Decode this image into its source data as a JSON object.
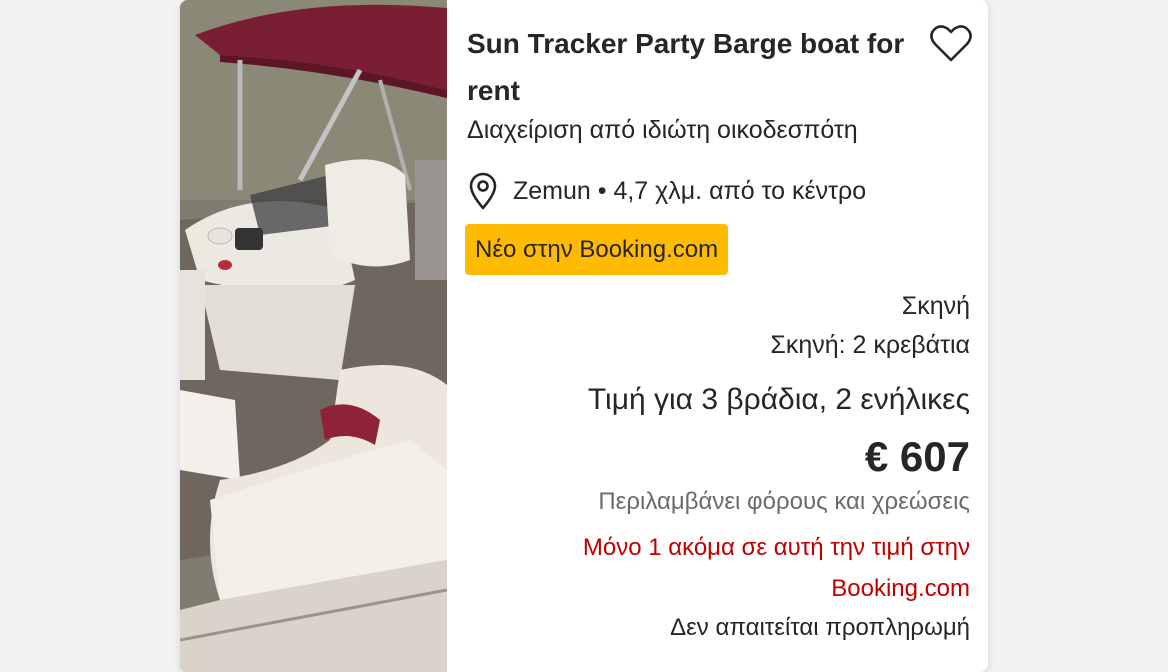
{
  "listing": {
    "title": "Sun Tracker Party Barge boat for rent",
    "subtitle": "Διαχείριση από ιδιώτη οικοδεσπότη",
    "location": "Zemun • 4,7 χλμ. από το κέντρο",
    "badge": "Νέο στην Booking.com",
    "room_type": "Σκηνή",
    "beds": "Σκηνή: 2 κρεβάτια",
    "price_for": "Τιμή για 3 βράδια, 2 ενήλικες",
    "price": "€ 607",
    "taxes": "Περιλαμβάνει φόρους και χρεώσεις",
    "scarcity": "Μόνο 1 ακόμα σε αυτή την τιμή στην Booking.com",
    "prepayment": "Δεν απαιτείται προπληρωμή"
  },
  "icons": {
    "favorite": "heart-icon",
    "location": "map-pin-icon"
  },
  "colors": {
    "badge": "#febb02",
    "scarcity": "#c00000",
    "canopy": "#7a1f33",
    "text": "#262626"
  }
}
